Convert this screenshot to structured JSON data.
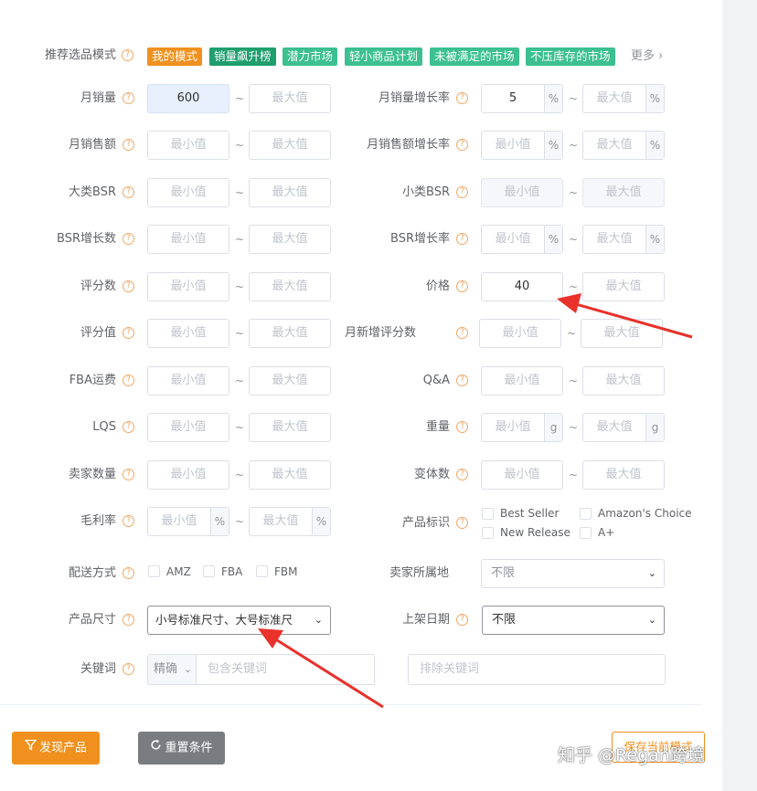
{
  "mode": {
    "label": "推荐选品模式",
    "tags": [
      {
        "label": "我的模式",
        "color": "#f0901e"
      },
      {
        "label": "销量飙升榜",
        "color": "#1f9e6e"
      },
      {
        "label": "潜力市场",
        "color": "#3cc08f"
      },
      {
        "label": "轻小商品计划",
        "color": "#3cc08f"
      },
      {
        "label": "未被满足的市场",
        "color": "#3cc08f"
      },
      {
        "label": "不压库存的市场",
        "color": "#3cc08f"
      }
    ],
    "more": "更多"
  },
  "placeholders": {
    "min": "最小值",
    "max": "最大值"
  },
  "units": {
    "percent": "%",
    "gram": "g"
  },
  "tilde": "~",
  "help_glyph": "?",
  "fields": {
    "monthly_sales": {
      "label": "月销量",
      "min": "600"
    },
    "monthly_sales_growth": {
      "label": "月销量增长率",
      "min": "5"
    },
    "monthly_revenue": {
      "label": "月销售额"
    },
    "monthly_revenue_growth": {
      "label": "月销售额增长率"
    },
    "main_bsr": {
      "label": "大类BSR"
    },
    "sub_bsr": {
      "label": "小类BSR"
    },
    "bsr_growth_count": {
      "label": "BSR增长数"
    },
    "bsr_growth_rate": {
      "label": "BSR增长率"
    },
    "rating_count": {
      "label": "评分数"
    },
    "price": {
      "label": "价格",
      "min": "40"
    },
    "rating_value": {
      "label": "评分值"
    },
    "monthly_new_ratings": {
      "label": "月新增评分数"
    },
    "fba_fee": {
      "label": "FBA运费"
    },
    "qa": {
      "label": "Q&A"
    },
    "lqs": {
      "label": "LQS"
    },
    "weight": {
      "label": "重量"
    },
    "seller_count": {
      "label": "卖家数量"
    },
    "variant_count": {
      "label": "变体数"
    },
    "margin": {
      "label": "毛利率"
    },
    "product_badges": {
      "label": "产品标识",
      "options": [
        "Best Seller",
        "Amazon's Choice",
        "New Release",
        "A+"
      ]
    },
    "shipping": {
      "label": "配送方式",
      "options": [
        "AMZ",
        "FBA",
        "FBM"
      ]
    },
    "seller_location": {
      "label": "卖家所属地",
      "value": "不限"
    },
    "product_size": {
      "label": "产品尺寸",
      "value": "小号标准尺寸、大号标准尺"
    },
    "listing_date": {
      "label": "上架日期",
      "value": "不限"
    },
    "keyword": {
      "label": "关键词",
      "match": "精确",
      "include_placeholder": "包含关键词",
      "exclude_placeholder": "排除关键词"
    }
  },
  "buttons": {
    "discover": "发现产品",
    "reset": "重置条件",
    "save": "保存当前模式"
  },
  "watermark": "知乎 @Regan跨境",
  "colors": {
    "accent": "#f0901e",
    "arrow": "#e8322b",
    "reset": "#7a7c80"
  }
}
